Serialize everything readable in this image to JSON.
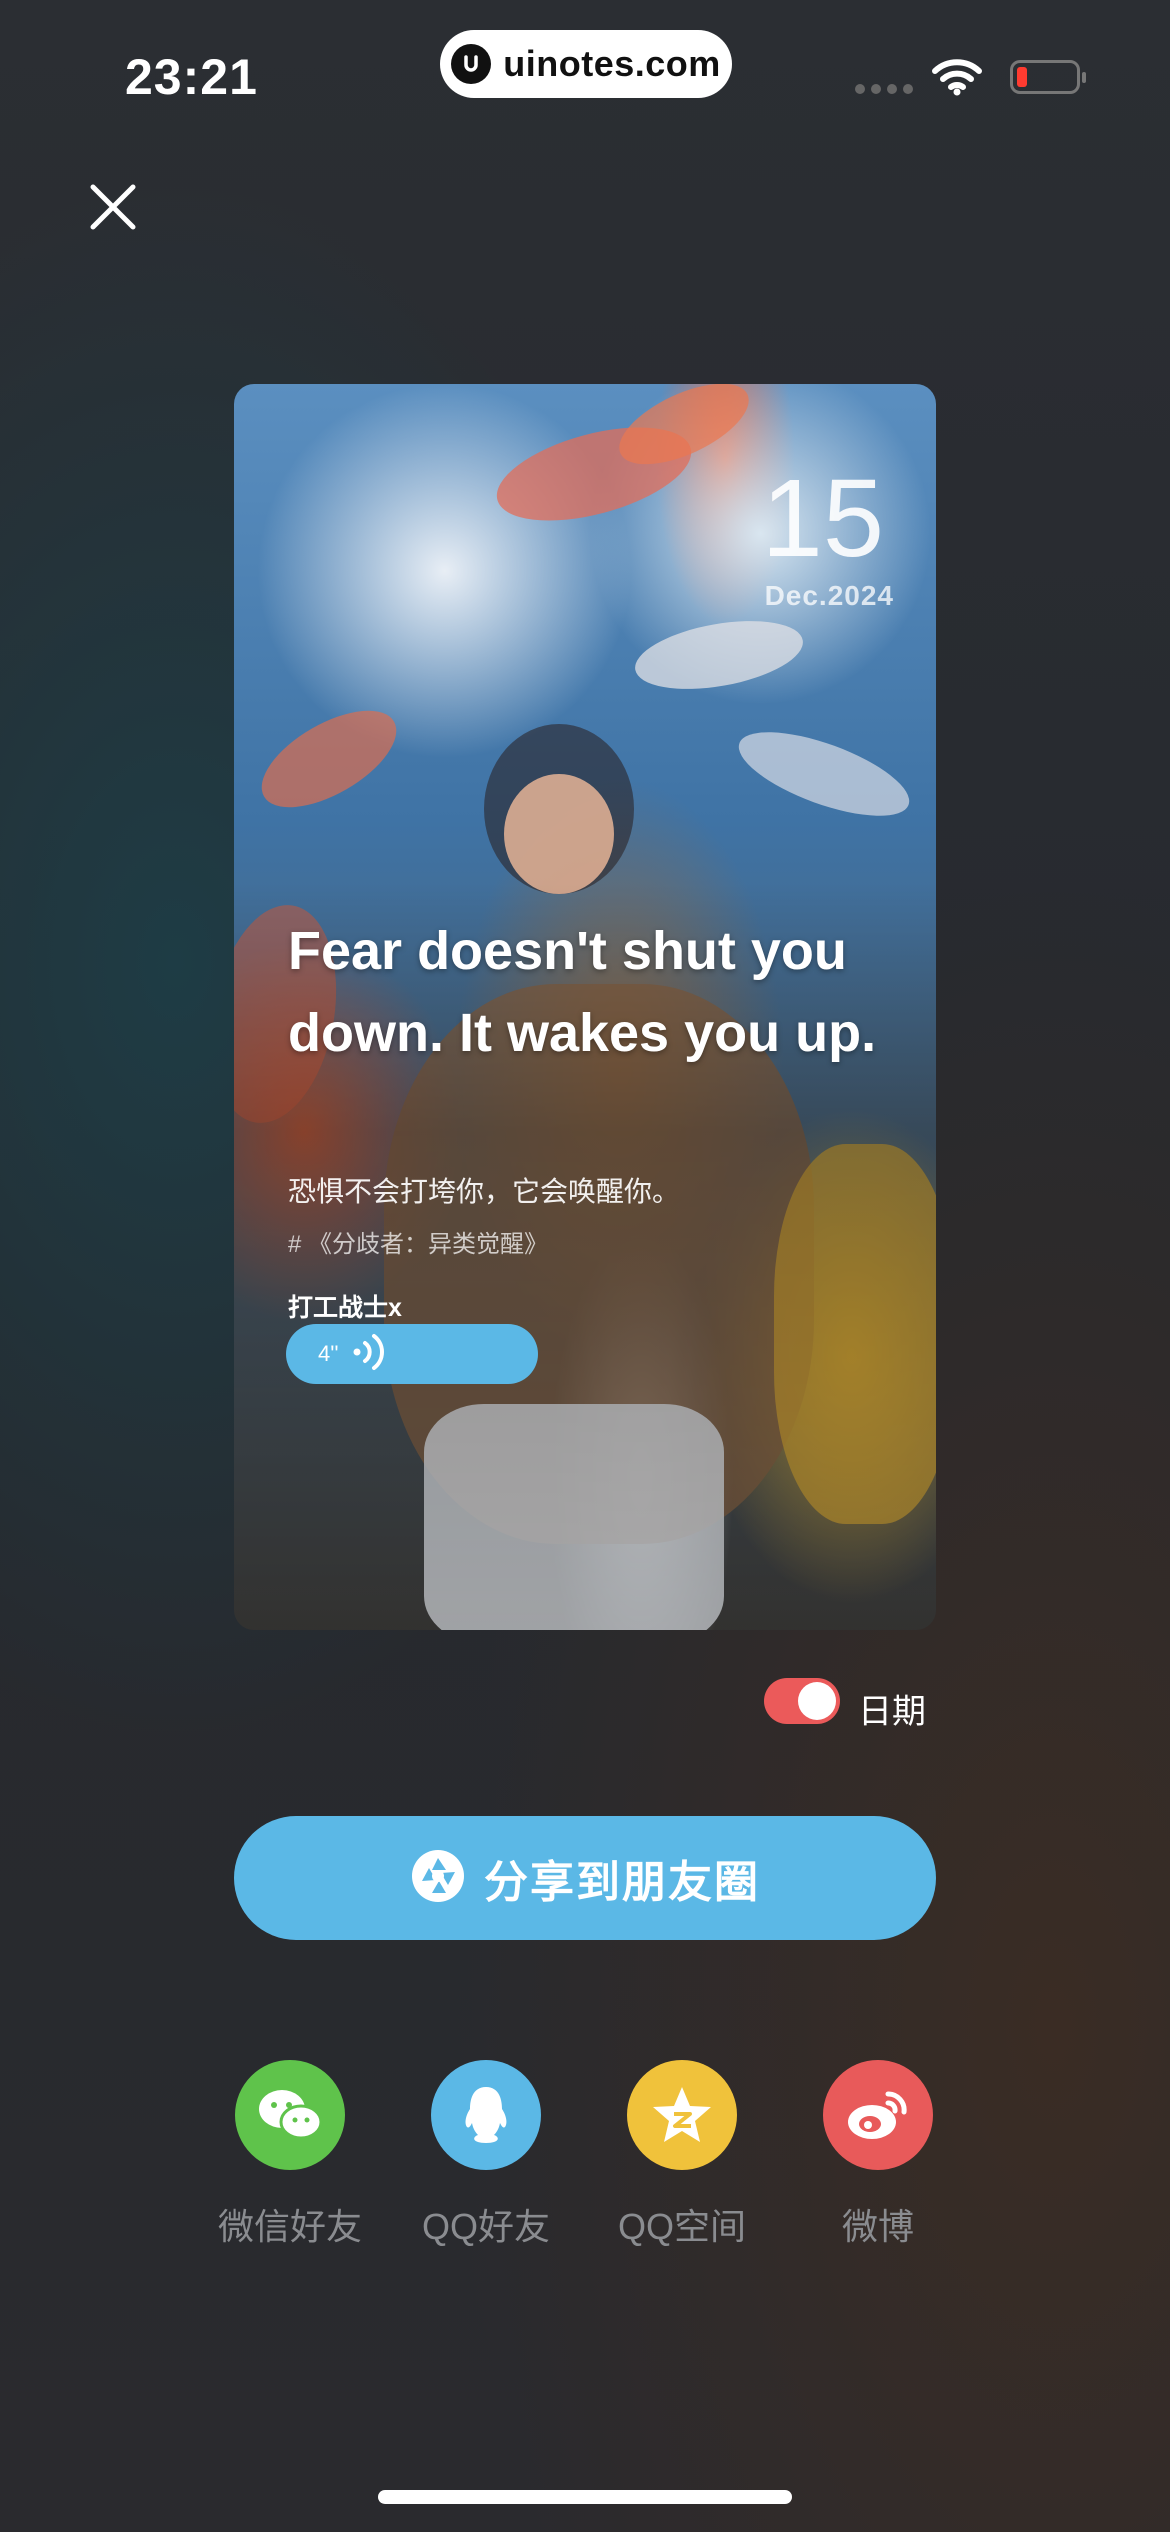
{
  "status_bar": {
    "time": "23:21",
    "url": "uinotes.com",
    "battery_color": "#ff3b30"
  },
  "close_icon": "close-icon",
  "card": {
    "day": "15",
    "month_year": "Dec.2024",
    "quote_en": "Fear doesn't shut you down. It wakes you up.",
    "quote_cn": "恐惧不会打垮你，它会唤醒你。",
    "source": "# 《分歧者：异类觉醒》",
    "author": "打工战士x",
    "voice_duration": "4''"
  },
  "toggle": {
    "label": "日期",
    "on": true,
    "color": "#eb5a5a"
  },
  "share_button": {
    "label": "分享到朋友圈",
    "icon": "moments-icon",
    "color": "#5bb8e6"
  },
  "social": [
    {
      "label": "微信好友",
      "icon": "wechat-icon",
      "color": "#5fc34b"
    },
    {
      "label": "QQ好友",
      "icon": "qq-icon",
      "color": "#5bb8e6"
    },
    {
      "label": "QQ空间",
      "icon": "qzone-icon",
      "color": "#f0c23b"
    },
    {
      "label": "微博",
      "icon": "weibo-icon",
      "color": "#e85a5a"
    }
  ]
}
